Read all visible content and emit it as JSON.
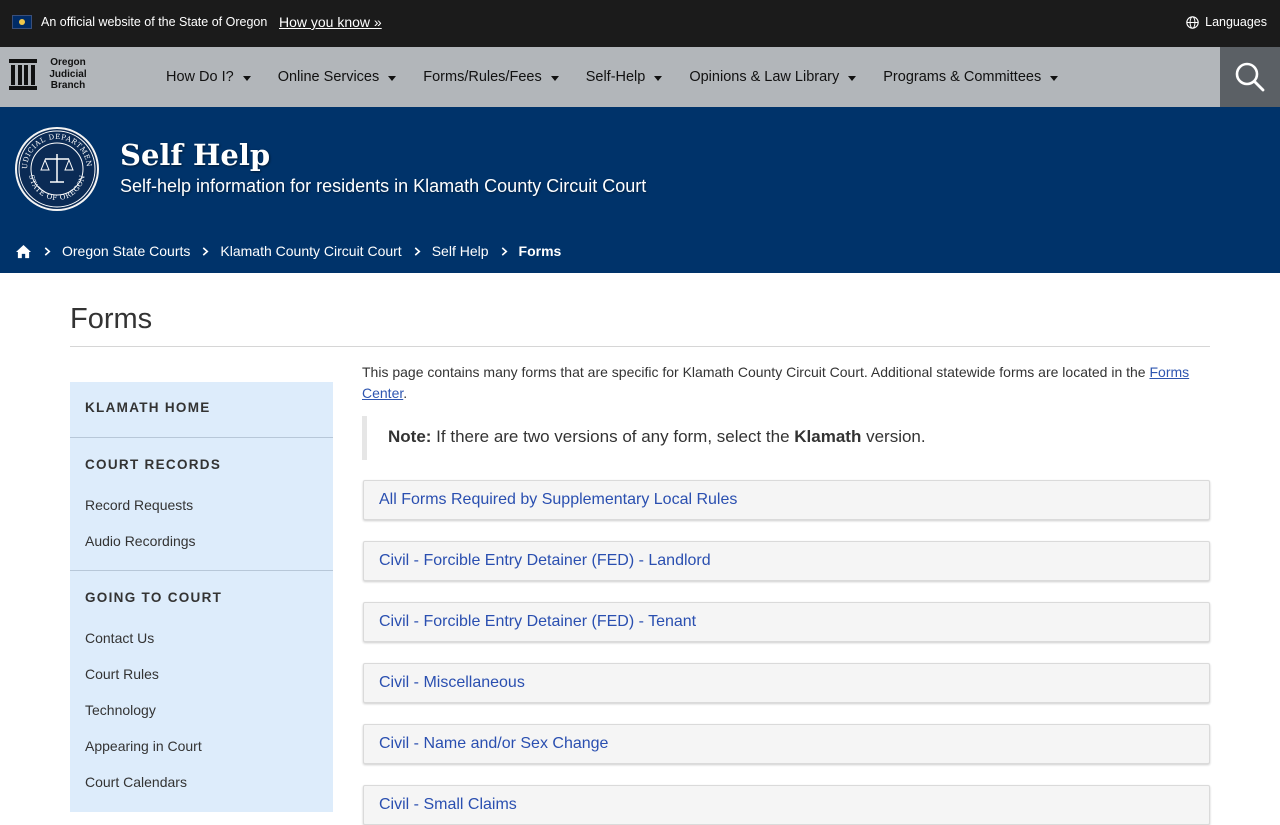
{
  "official_bar": {
    "text": "An official website of the State of Oregon",
    "how_you_know": "How you know »",
    "languages": "Languages"
  },
  "brand": {
    "line1": "Oregon",
    "line2": "Judicial",
    "line3": "Branch"
  },
  "nav": {
    "items": [
      {
        "label": "How Do I?"
      },
      {
        "label": "Online Services"
      },
      {
        "label": "Forms/Rules/Fees"
      },
      {
        "label": "Self-Help"
      },
      {
        "label": "Opinions & Law Library"
      },
      {
        "label": "Programs & Committees"
      }
    ]
  },
  "hero": {
    "title": "Self Help",
    "subtitle": "Self-help information for residents in Klamath County Circuit Court",
    "seal_text_top": "JUDICIAL DEPARTMENT",
    "seal_text_bottom": "STATE OF OREGON"
  },
  "breadcrumb": {
    "items": [
      {
        "label": "Oregon State Courts"
      },
      {
        "label": "Klamath County Circuit Court"
      },
      {
        "label": "Self Help"
      }
    ],
    "current": "Forms"
  },
  "page": {
    "title": "Forms"
  },
  "sidebar": {
    "sections": [
      {
        "heading": "Klamath Home",
        "links": []
      },
      {
        "heading": "Court Records",
        "links": [
          {
            "label": "Record Requests"
          },
          {
            "label": "Audio Recordings"
          }
        ]
      },
      {
        "heading": "Going to Court",
        "links": [
          {
            "label": "Contact Us"
          },
          {
            "label": "Court Rules"
          },
          {
            "label": "Technology"
          },
          {
            "label": "Appearing in Court"
          },
          {
            "label": "Court Calendars"
          }
        ]
      }
    ]
  },
  "content": {
    "intro_text": "This page contains many forms that are specific for Klamath County Circuit Court. Additional statewide forms are located in the ",
    "intro_link": "Forms Center",
    "intro_end": ".",
    "note_label": "Note:",
    "note_text": " If there are two versions of any form, select the ",
    "note_bold": "Klamath",
    "note_end": " version.",
    "accordions": [
      {
        "label": "All Forms Required by Supplementary Local Rules"
      },
      {
        "label": "Civil - Forcible Entry Detainer (FED) - Landlord"
      },
      {
        "label": "Civil - Forcible Entry Detainer (FED) - Tenant"
      },
      {
        "label": "Civil - Miscellaneous"
      },
      {
        "label": "Civil - Name and/or Sex Change"
      },
      {
        "label": "Civil - Small Claims"
      }
    ]
  },
  "colors": {
    "official_bar": "#1b1b1b",
    "nav_bg": "#b2b6ba",
    "hero_bg": "#00336a",
    "sidebar_bg": "#ddecfb",
    "link": "#2a4fb0"
  }
}
